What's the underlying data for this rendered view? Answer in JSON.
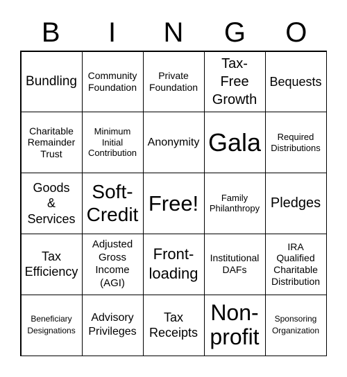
{
  "header": [
    "B",
    "I",
    "N",
    "G",
    "O"
  ],
  "cells": [
    "Bundling",
    "Community\nFoundation",
    "Private\nFoundation",
    "Tax-\nFree\nGrowth",
    "Bequests",
    "Charitable\nRemainder\nTrust",
    "Minimum\nInitial\nContribution",
    "Anonymity",
    "Gala",
    "Required\nDistributions",
    "Goods\n&\nServices",
    "Soft-\nCredit",
    "Free!",
    "Family\nPhilanthropy",
    "Pledges",
    "Tax\nEfficiency",
    "Adjusted\nGross\nIncome\n(AGI)",
    "Front-\nloading",
    "Institutional\nDAFs",
    "IRA\nQualified\nCharitable\nDistribution",
    "Beneficiary\nDesignations",
    "Advisory\nPrivileges",
    "Tax\nReceipts",
    "Non-\nprofit",
    "Sponsoring\nOrganization"
  ]
}
